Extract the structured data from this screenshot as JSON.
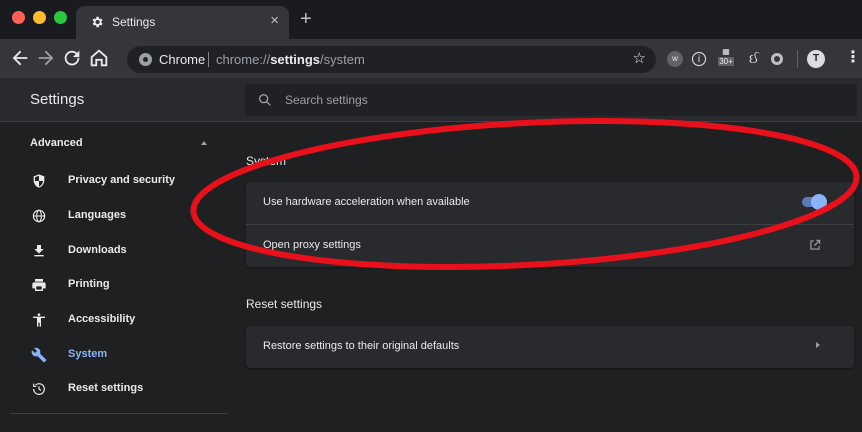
{
  "browser": {
    "tab_title": "Settings",
    "tab_close": "×",
    "new_tab": "+",
    "site_chip": "Chrome",
    "url_prefix": "chrome://",
    "url_bold": "settings",
    "url_suffix": "/system",
    "ext_badge": "30+",
    "profile_initial": "T"
  },
  "header": {
    "title": "Settings",
    "search_placeholder": "Search settings"
  },
  "sidebar": {
    "section": "Advanced",
    "items": [
      {
        "label": "Privacy and security",
        "icon": "shield-icon"
      },
      {
        "label": "Languages",
        "icon": "globe-icon"
      },
      {
        "label": "Downloads",
        "icon": "download-icon"
      },
      {
        "label": "Printing",
        "icon": "printer-icon"
      },
      {
        "label": "Accessibility",
        "icon": "accessibility-icon"
      },
      {
        "label": "System",
        "icon": "wrench-icon",
        "active": true
      },
      {
        "label": "Reset settings",
        "icon": "history-icon"
      }
    ]
  },
  "main": {
    "system": {
      "title": "System",
      "rows": [
        {
          "label": "Use hardware acceleration when available",
          "control": "toggle",
          "on": true
        },
        {
          "label": "Open proxy settings",
          "control": "external-link"
        }
      ]
    },
    "reset": {
      "title": "Reset settings",
      "rows": [
        {
          "label": "Restore settings to their original defaults",
          "control": "chevron"
        }
      ]
    }
  },
  "colors": {
    "accent": "#8ab4f8",
    "annotation": "#e8101a"
  }
}
